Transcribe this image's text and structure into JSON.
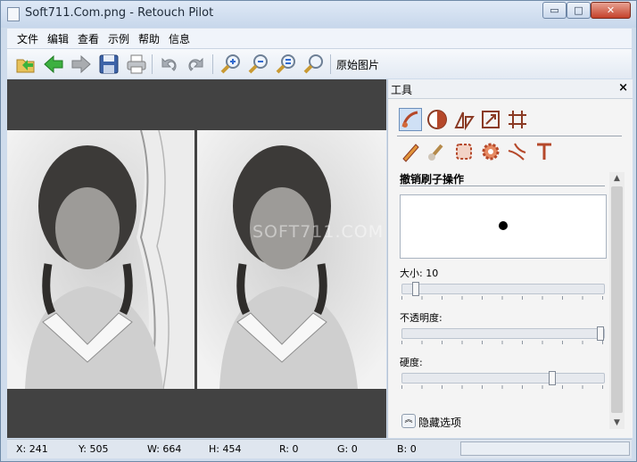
{
  "window": {
    "title": "Soft711.Com.png - Retouch Pilot",
    "minimize_label": "▭",
    "maximize_label": "□",
    "close_label": "✕"
  },
  "menu": [
    "文件",
    "编辑",
    "查看",
    "示例",
    "帮助",
    "信息"
  ],
  "toolbar": {
    "icons": [
      "open-folder-icon",
      "back-arrow-icon",
      "forward-arrow-icon",
      "save-disk-icon",
      "print-icon",
      "undo-icon",
      "redo-icon",
      "zoom-in-icon",
      "zoom-out-icon",
      "zoom-fit-icon",
      "zoom-actual-icon"
    ],
    "original_label": "原始图片"
  },
  "canvas": {
    "watermark": "SOFT711.COM",
    "background": "#424242"
  },
  "panel": {
    "title": "工具",
    "close_label": "×",
    "tools_row1": [
      "brush-scratch-tool-icon",
      "clone-stamp-tool-icon",
      "transform-tool-icon",
      "resize-tool-icon",
      "crop-grid-tool-icon"
    ],
    "tools_row2": [
      "pencil-tool-icon",
      "smudge-brush-tool-icon",
      "patch-tool-icon",
      "gear-repair-tool-icon",
      "line-scratch-tool-icon",
      "text-tool-icon"
    ],
    "section_title": "撤销刷子操作",
    "size_label": "大小:",
    "size_value": "10",
    "size_level": 0.05,
    "opacity_label": "不透明度:",
    "opacity_level": 1.0,
    "hardness_label": "硬度:",
    "hardness_level": 0.75,
    "hide_options_label": "隐藏选项"
  },
  "status": {
    "x": "X: 241",
    "y": "Y: 505",
    "w": "W: 664",
    "h": "H: 454",
    "r": "R: 0",
    "g": "G: 0",
    "b": "B: 0"
  }
}
